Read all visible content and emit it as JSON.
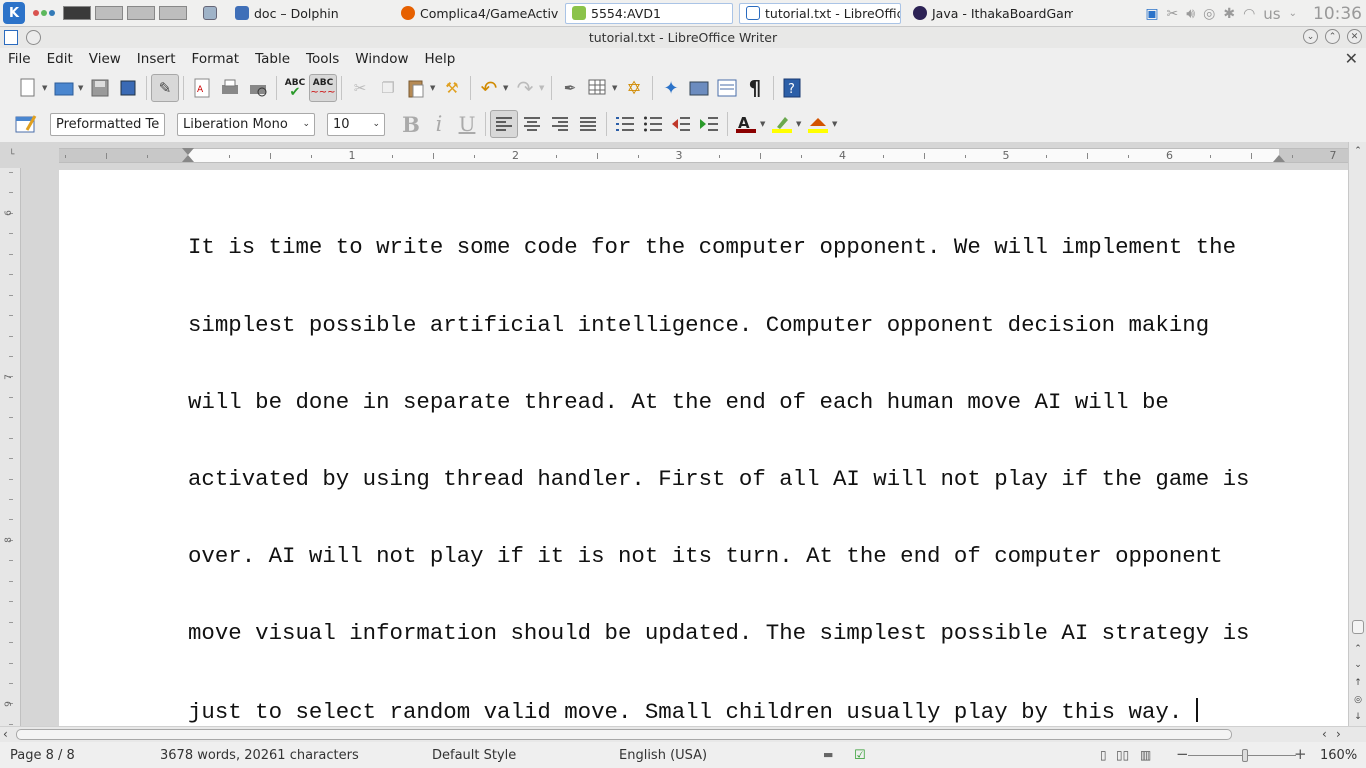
{
  "taskbar": {
    "tasks": [
      {
        "label": "doc – Dolphin",
        "icon": "dolphin-icon",
        "color": "#3f6fb8"
      },
      {
        "label": "Complica4/GameActivit",
        "icon": "firefox-icon",
        "color": "#e66000"
      },
      {
        "label": "5554:AVD1",
        "icon": "android-icon",
        "color": "#8bc34a"
      },
      {
        "label": "tutorial.txt - LibreOffice",
        "icon": "writer-icon",
        "color": "#2a6bbf"
      },
      {
        "label": "Java - IthakaBoardGame",
        "icon": "eclipse-icon",
        "color": "#2c2255"
      }
    ],
    "keyboard_layout": "us",
    "clock": "10:36"
  },
  "window": {
    "title": "tutorial.txt - LibreOffice Writer"
  },
  "menu": [
    "File",
    "Edit",
    "View",
    "Insert",
    "Format",
    "Table",
    "Tools",
    "Window",
    "Help"
  ],
  "formatting": {
    "paragraph_style": "Preformatted Te",
    "font_name": "Liberation Mono",
    "font_size": "10"
  },
  "ruler": {
    "numbers": [
      "1",
      "2",
      "3",
      "4",
      "5",
      "6",
      "7"
    ]
  },
  "vruler": {
    "numbers": [
      "6",
      "7",
      "8",
      "9"
    ]
  },
  "document": {
    "lines": [
      "It is time to write some code for the computer opponent. We will implement the",
      "simplest possible artificial intelligence. Computer opponent decision making",
      "will be done in separate thread. At the end of each human move AI will be",
      "activated by using thread handler. First of all AI will not play if the game is",
      "over. AI will not play if it is not its turn. At the end of computer opponent",
      "move visual information should be updated. The simplest possible AI strategy is",
      "just to select random valid move. Small children usually play by this way. "
    ]
  },
  "status": {
    "page": "Page 8 / 8",
    "words": "3678 words, 20261 characters",
    "style": "Default Style",
    "language": "English (USA)",
    "zoom": "160%"
  },
  "colors": {
    "accent": "#2c73c9",
    "toolbar_bg": "#efefef",
    "page_bg": "#ffffff"
  }
}
